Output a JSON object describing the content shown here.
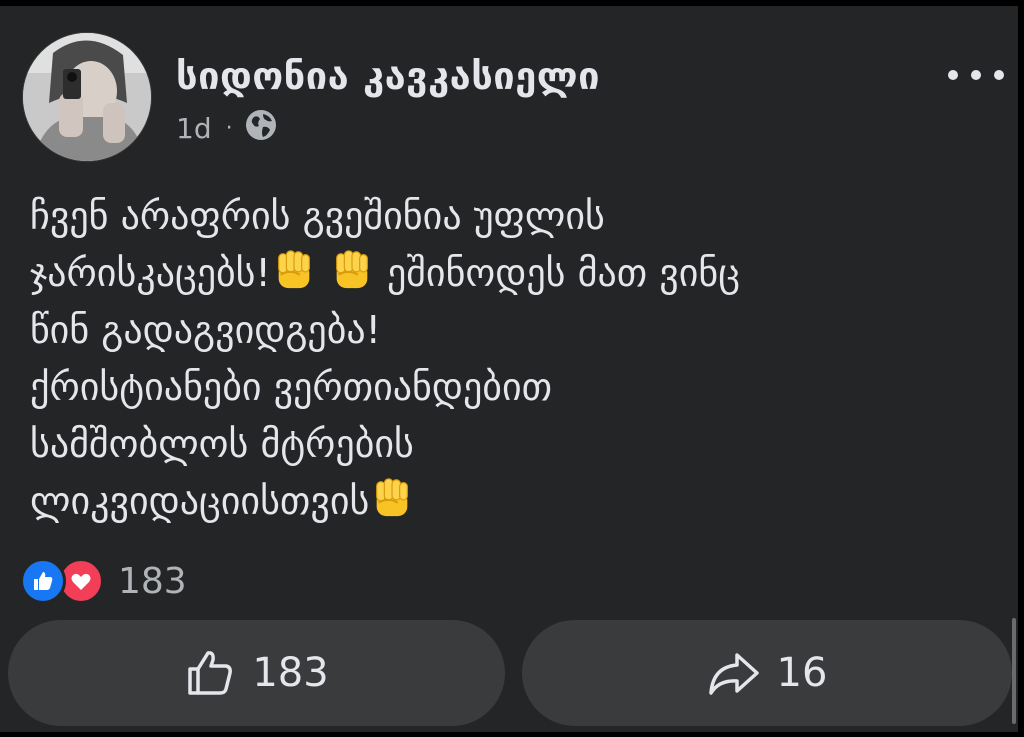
{
  "post": {
    "author": "სიდონია კავკასიელი",
    "timestamp": "1d",
    "separator": "·",
    "privacy_icon": "globe-icon",
    "more_icon": "more-options-icon",
    "text_lines": [
      "ჩვენ არაფრის გვეშინია უფლის",
      "ჯარისკაცებს!",
      " ეშინოდეს მათ ვინც",
      "წინ გადაგვიდგება!",
      " ქრისტიანები ვერთიანდებით",
      "სამშობლოს მტრების",
      "ლიკვიდაციისთვის"
    ],
    "emoji": "raised-fist-emoji"
  },
  "reactions": {
    "types": [
      "like-icon",
      "love-icon"
    ],
    "count": "183"
  },
  "actions": {
    "like_count": "183",
    "share_count": "16"
  },
  "colors": {
    "card_bg": "#242526",
    "button_bg": "#3a3b3c",
    "text": "#e4e6eb",
    "secondary_text": "#b0b3b8",
    "like_blue": "#1877f2",
    "love_red": "#f33e58"
  }
}
